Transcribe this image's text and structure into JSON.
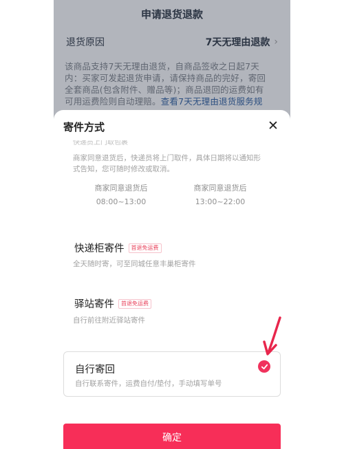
{
  "background": {
    "title": "申请退货退款",
    "reason_label": "退货原因",
    "reason_value": "7天无理由退款",
    "notice_line1": "该商品支持7天无理由退货，自商品签收之日起7天",
    "notice_line2": "内：买家可发起退货申请，请保持商品的完好，寄回",
    "notice_line3": "全套商品(包含附件、赠品等)；商品退回的运费如有",
    "notice_line4_text": "可用运费险则自动理赔。",
    "notice_link": "查看7天无理由退货服务规"
  },
  "sheet": {
    "title": "寄件方式",
    "cutoff_text": "快递员上门取包裹",
    "pickup": {
      "desc_line1": "商家同意退货后，快递员将上门取件，具体日期将以通知形",
      "desc_line2": "式告知，您可随时修改或取消。",
      "slots": [
        {
          "label": "商家同意退货后",
          "time": "08:00~13:00"
        },
        {
          "label": "商家同意退货后",
          "time": "13:00~22:00"
        }
      ]
    },
    "options": [
      {
        "title": "快递柜寄件",
        "badge": "首退免运费",
        "desc": "全天随时寄，可至同城任意丰巢柜寄件"
      },
      {
        "title": "驿站寄件",
        "badge": "首退免运费",
        "desc": "自行前往附近驿站寄件"
      },
      {
        "title": "自行寄回",
        "desc": "自行联系寄件，运费自付/垫付，手动填写单号",
        "selected": true
      }
    ],
    "confirm_label": "确定"
  },
  "colors": {
    "accent": "#f72e58",
    "badge": "#e8415a",
    "link": "#2f5d9c",
    "annotation_arrow": "#e8264c"
  },
  "icons": {
    "close": "close-icon",
    "check": "check-icon",
    "chevron": "chevron-right-icon"
  }
}
